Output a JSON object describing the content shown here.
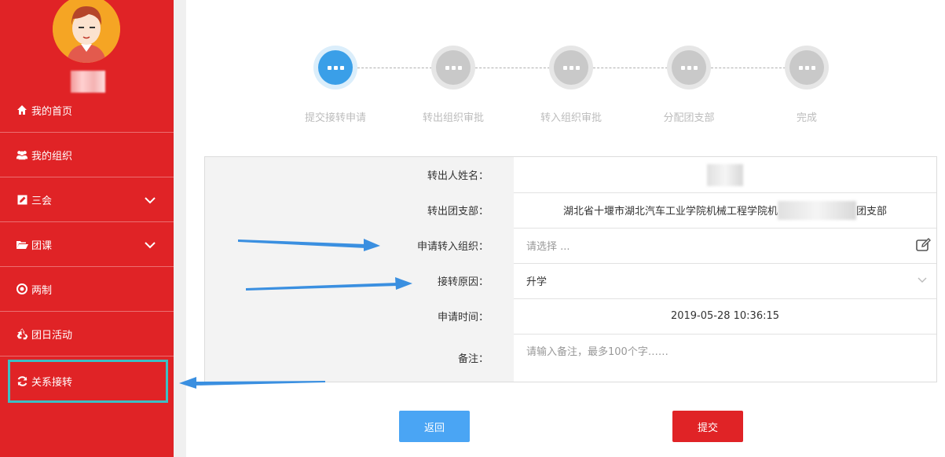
{
  "sidebar": {
    "items": [
      {
        "label": "我的首页",
        "icon": "home-icon"
      },
      {
        "label": "我的组织",
        "icon": "users-icon"
      },
      {
        "label": "三会",
        "icon": "edit-icon"
      },
      {
        "label": "团课",
        "icon": "folder-open-icon"
      },
      {
        "label": "两制",
        "icon": "target-icon"
      },
      {
        "label": "团日活动",
        "icon": "recycle-icon"
      },
      {
        "label": "关系接转",
        "icon": "refresh-icon"
      }
    ]
  },
  "steps": [
    {
      "label": "提交接转申请"
    },
    {
      "label": "转出组织审批"
    },
    {
      "label": "转入组织审批"
    },
    {
      "label": "分配团支部"
    },
    {
      "label": "完成"
    }
  ],
  "form": {
    "from_name_label": "转出人姓名：",
    "from_branch_label": "转出团支部：",
    "from_branch_value_start": "湖北省十堰市湖北汽车工业学院机械工程学院机",
    "from_branch_value_end": "团支部",
    "to_org_label": "申请转入组织：",
    "to_org_placeholder": "请选择 ...",
    "reason_label": "接转原因：",
    "reason_value": "升学",
    "time_label": "申请时间：",
    "time_value": "2019-05-28 10:36:15",
    "remark_label": "备注：",
    "remark_placeholder": "请输入备注，最多100个字……"
  },
  "buttons": {
    "back": "返回",
    "submit": "提交"
  },
  "colors": {
    "brand_red": "#e02326",
    "active_blue": "#3a9fe8",
    "arrow_blue": "#3a8fe0",
    "highlight_teal": "#3dbfc4"
  }
}
